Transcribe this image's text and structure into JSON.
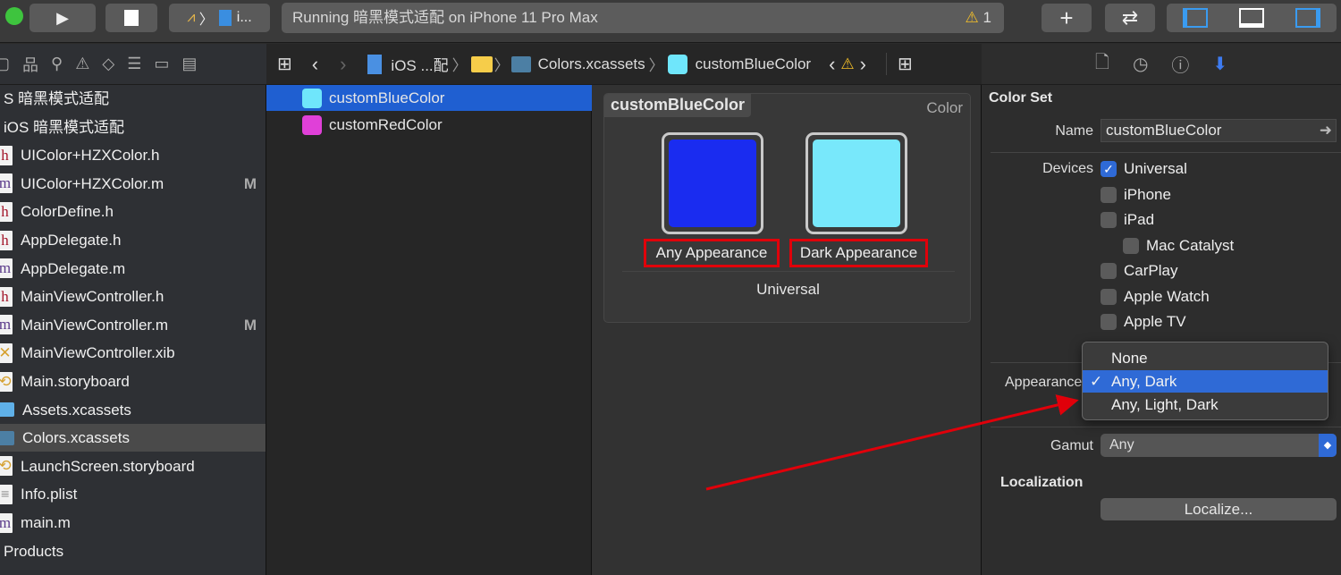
{
  "toolbar": {
    "scheme": "i...",
    "status": "Running 暗黑模式适配 on iPhone 11 Pro Max",
    "warning_count": "1",
    "plus": "+",
    "swap": "⇄"
  },
  "sidebar": {
    "items": [
      {
        "label": "S 暗黑模式适配",
        "type": "project"
      },
      {
        "label": "iOS 暗黑模式适配",
        "type": "group"
      },
      {
        "label": "UIColor+HZXColor.h",
        "type": "h"
      },
      {
        "label": "UIColor+HZXColor.m",
        "type": "m",
        "badge": "M"
      },
      {
        "label": "ColorDefine.h",
        "type": "h"
      },
      {
        "label": "AppDelegate.h",
        "type": "h"
      },
      {
        "label": "AppDelegate.m",
        "type": "m"
      },
      {
        "label": "MainViewController.h",
        "type": "h"
      },
      {
        "label": "MainViewController.m",
        "type": "m",
        "badge": "M"
      },
      {
        "label": "MainViewController.xib",
        "type": "xib"
      },
      {
        "label": "Main.storyboard",
        "type": "storyboard"
      },
      {
        "label": "Assets.xcassets",
        "type": "xcassets"
      },
      {
        "label": "Colors.xcassets",
        "type": "xcassets",
        "selected": true
      },
      {
        "label": "LaunchScreen.storyboard",
        "type": "storyboard"
      },
      {
        "label": "Info.plist",
        "type": "plist"
      },
      {
        "label": "main.m",
        "type": "m"
      },
      {
        "label": "Products",
        "type": "group"
      }
    ]
  },
  "jumpbar": {
    "project": "iOS ...配",
    "catalog": "Colors.xcassets",
    "asset": "customBlueColor"
  },
  "assets": [
    {
      "label": "customBlueColor",
      "color": "#6fe6fb",
      "selected": true
    },
    {
      "label": "customRedColor",
      "color": "#e040d8"
    }
  ],
  "editor": {
    "title": "customBlueColor",
    "type": "Color",
    "any_label": "Any Appearance",
    "dark_label": "Dark Appearance",
    "any_color": "#1a2cf0",
    "dark_color": "#78e8fb",
    "device": "Universal"
  },
  "inspector": {
    "section": "Color Set",
    "name_label": "Name",
    "name_value": "customBlueColor",
    "devices_label": "Devices",
    "devices": [
      {
        "label": "Universal",
        "checked": true
      },
      {
        "label": "iPhone",
        "checked": false
      },
      {
        "label": "iPad",
        "checked": false
      },
      {
        "label": "Mac Catalyst",
        "checked": false
      },
      {
        "label": "CarPlay",
        "checked": false
      },
      {
        "label": "Apple Watch",
        "checked": false
      },
      {
        "label": "Apple TV",
        "checked": false
      }
    ],
    "appearance_label": "Appearances",
    "appearance_options": [
      "None",
      "Any, Dark",
      "Any, Light, Dark"
    ],
    "appearance_selected": "Any, Dark",
    "check": "✓",
    "gamut_label": "Gamut",
    "gamut_value": "Any",
    "localization": "Localization",
    "localize_button": "Localize..."
  },
  "colors": {
    "accent": "#2f6ad6",
    "annotation": "#e0000a"
  }
}
